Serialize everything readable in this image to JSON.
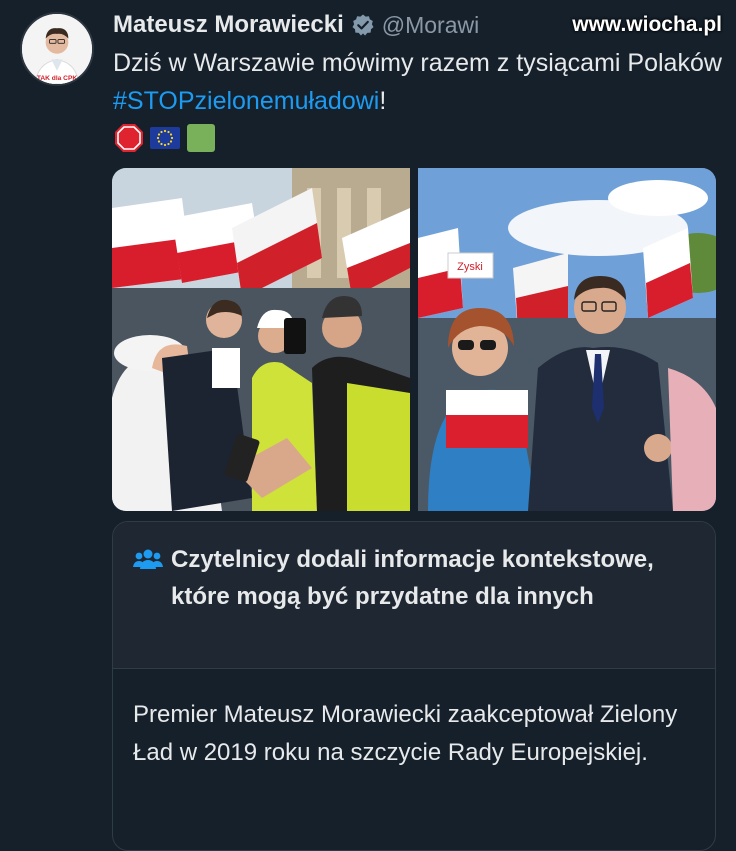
{
  "author": {
    "name": "Mateusz Morawiecki",
    "handle": "@Morawi",
    "avatar_caption": "TAK dla CPK"
  },
  "watermark": "www.wiocha.pl",
  "tweet": {
    "text_before": "Dziś w Warszawie mówimy razem z tysiącami Polaków ",
    "hashtag": "#STOPzielonemuładowi",
    "text_after": "!",
    "emojis": [
      "stop-sign",
      "eu-flag",
      "green-square"
    ]
  },
  "photos": [
    {
      "description_name": "selfie-with-supporters"
    },
    {
      "description_name": "march-with-woman",
      "sign_text": "Zyski"
    }
  ],
  "community_note": {
    "title": "Czytelnicy dodali informacje kontekstowe, które mogą być przydatne dla innych",
    "body": "Premier Mateusz Morawiecki zaakceptował Zielony Ład w 2019 roku na szczycie Rady Europejskiej."
  },
  "colors": {
    "background": "#15202b",
    "hashtag": "#1d9bf0",
    "verified": "#829aab",
    "note_icon": "#1d9bf0"
  }
}
